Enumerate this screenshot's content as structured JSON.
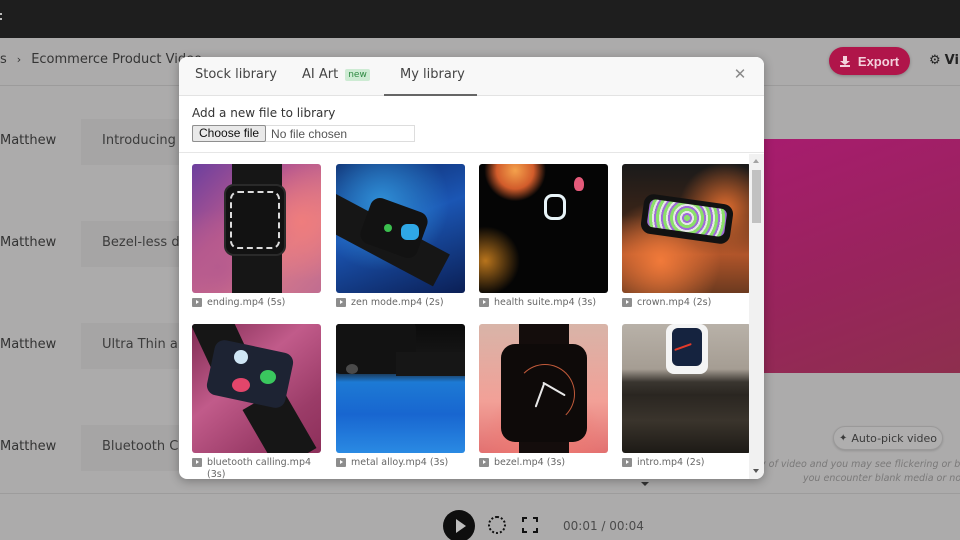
{
  "header": {
    "breadcrumb": [
      "s",
      "Ecommerce Product Video"
    ],
    "export_label": "Export",
    "settings_label": "Vi",
    "icons": {
      "export": "download-icon",
      "settings": "gear-icon"
    }
  },
  "scenes": [
    {
      "speaker": "Matthew",
      "text": "Introducing P"
    },
    {
      "speaker": "Matthew",
      "text": "Bezel-less de"
    },
    {
      "speaker": "Matthew",
      "text": "Ultra Thin an"
    },
    {
      "speaker": "Matthew",
      "text": "Bluetooth Ca"
    }
  ],
  "preview": {
    "autopick_label": "Auto-pick video",
    "warning_lines": [
      "v of video and you may see flickering or blank",
      "you encounter blank media or no au"
    ],
    "colors": {
      "preview_fill": "#a71c6e"
    }
  },
  "player": {
    "time": "00:01 / 00:04",
    "icons": {
      "play": "play-icon",
      "replay": "replay-icon",
      "fullscreen": "fullscreen-icon"
    }
  },
  "modal": {
    "tabs": [
      {
        "label": "Stock library",
        "active": false
      },
      {
        "label": "AI Art",
        "badge": "new",
        "active": false
      },
      {
        "label": "My library",
        "active": true
      }
    ],
    "close_icon": "close-icon",
    "upload": {
      "label": "Add a new file to library",
      "button_label": "Choose file",
      "status": "No file chosen"
    },
    "files": [
      {
        "name": "ending.mp4 (5s)"
      },
      {
        "name": "zen mode.mp4 (2s)"
      },
      {
        "name": "health suite.mp4 (3s)"
      },
      {
        "name": "crown.mp4 (2s)"
      },
      {
        "name": "bluetooth calling.mp4 (3s)"
      },
      {
        "name": "metal alloy.mp4 (3s)"
      },
      {
        "name": "bezel.mp4 (3s)"
      },
      {
        "name": "intro.mp4 (2s)"
      }
    ]
  },
  "colors": {
    "accent": "#b0154a",
    "badge_bg": "#cdebd3",
    "badge_text": "#2f8a43"
  }
}
